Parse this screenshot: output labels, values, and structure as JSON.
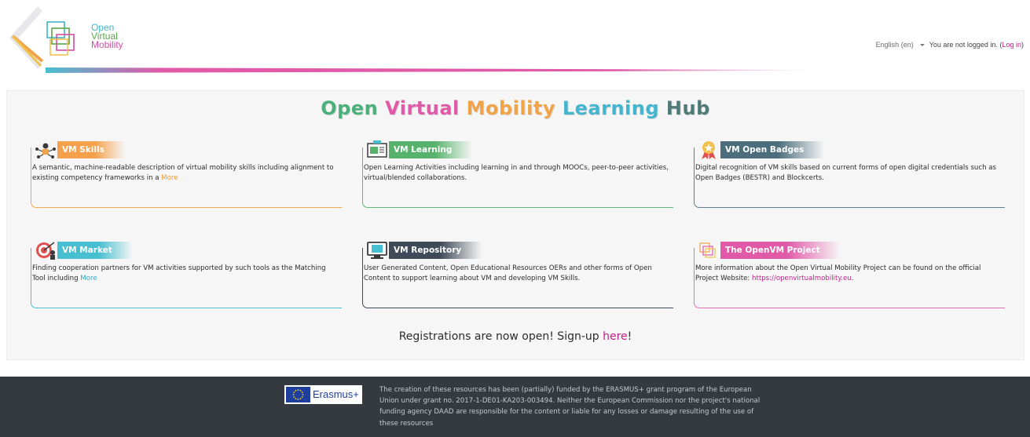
{
  "header": {
    "logo": {
      "line1": "Open",
      "line2": "Virtual",
      "line3": "Mobility"
    },
    "language": "English (en)",
    "login_status": "You are not logged in.",
    "login_open_paren": "(",
    "login_link": "Log in",
    "login_close_paren": ")"
  },
  "main": {
    "title": {
      "w1": "Open",
      "w2": "Virtual",
      "w3": "Mobility",
      "w4": "Learning",
      "w5": "Hub"
    },
    "cards": [
      {
        "icon": "skills-network-icon",
        "title": "VM Skills",
        "description": "A semantic, machine-readable description of virtual mobility skills including alignment to existing competency frameworks in a ",
        "link": "More"
      },
      {
        "icon": "learning-board-icon",
        "title": "VM Learning",
        "description": "Open Learning Activities including learning in and through MOOCs, peer-to-peer activities, virtual/blended collaborations."
      },
      {
        "icon": "badge-ribbon-icon",
        "title": "VM Open Badges",
        "description": "Digital recognition of VM skills based on current forms of open digital credentials such as Open Badges (BESTR) and Blockcerts."
      },
      {
        "icon": "target-market-icon",
        "title": "VM Market",
        "description": "Finding cooperation partners for VM activities supported by such tools as the Matching Tool including ",
        "link": "More"
      },
      {
        "icon": "repository-monitor-icon",
        "title": "VM Repository",
        "description": "User Generated Content, Open Educational Resources OERs and other forms of Open Content to support learning about VM and developing VM Skills."
      },
      {
        "icon": "project-squares-icon",
        "title": "The OpenVM Project",
        "description": "More information about the Open Virtual Mobility Project can be found on the official Project Website: ",
        "link": "https://openvirtualmobility.eu",
        "suffix": "."
      }
    ],
    "registration": {
      "text": "Registrations are now open! Sign-up ",
      "link": "here",
      "suffix": "!"
    }
  },
  "footer": {
    "erasmus_label": "Erasmus+",
    "text": "The creation of these resources has been (partially) funded by the ERASMUS+ grant program of the European Union under grant no. 2017-1-DE01-KA203-003494. Neither the European Commission nor the project's national funding agency DAAD are responsible for the content or liable for any losses or damage resulting of the use of these resources"
  },
  "colors": {
    "accent_pink": "#c21e88",
    "orange": "#f5a04a",
    "green": "#57b26b",
    "slate": "#4b6d7c",
    "cyan": "#48bfd0",
    "dark": "#3e4a57",
    "pink": "#e05aa8",
    "footer_bg": "#343a40"
  }
}
